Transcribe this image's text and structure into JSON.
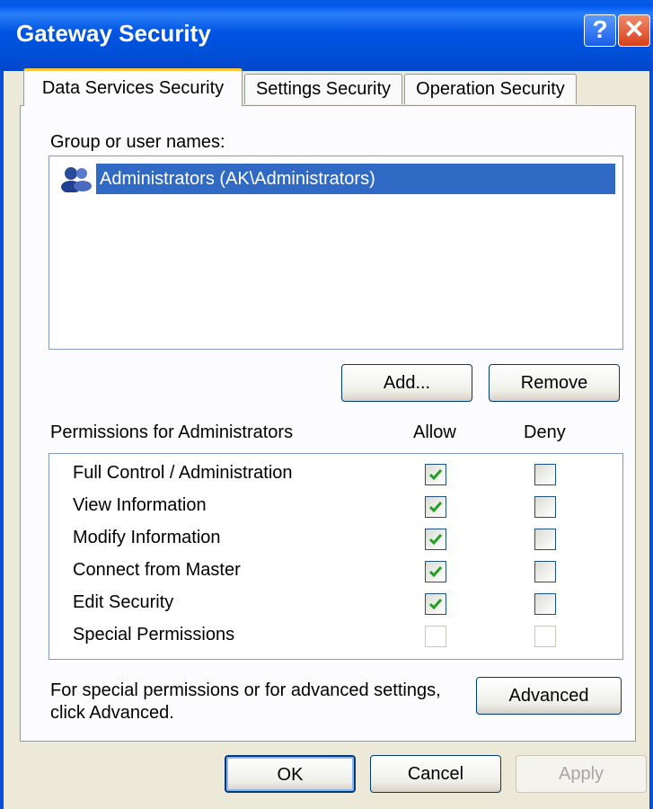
{
  "window": {
    "title": "Gateway Security",
    "help_glyph": "?",
    "close_glyph": "✕"
  },
  "tabs": [
    {
      "label": "Data Services Security",
      "active": true
    },
    {
      "label": "Settings Security",
      "active": false
    },
    {
      "label": "Operation Security",
      "active": false
    }
  ],
  "users": {
    "label": "Group or user names:",
    "items": [
      {
        "name": "Administrators (AK\\Administrators)",
        "selected": true,
        "icon": "group-icon"
      }
    ]
  },
  "user_buttons": {
    "add": "Add...",
    "remove": "Remove"
  },
  "permissions": {
    "header": "Permissions for Administrators",
    "allow_label": "Allow",
    "deny_label": "Deny",
    "rows": [
      {
        "name": "Full Control / Administration",
        "allow": true,
        "deny": false,
        "enabled": true
      },
      {
        "name": "View Information",
        "allow": true,
        "deny": false,
        "enabled": true
      },
      {
        "name": "Modify Information",
        "allow": true,
        "deny": false,
        "enabled": true
      },
      {
        "name": "Connect from Master",
        "allow": true,
        "deny": false,
        "enabled": true
      },
      {
        "name": "Edit Security",
        "allow": true,
        "deny": false,
        "enabled": true
      },
      {
        "name": "Special Permissions",
        "allow": false,
        "deny": false,
        "enabled": false
      }
    ]
  },
  "advanced": {
    "text_line1": "For special permissions or for advanced settings,",
    "text_line2": "click Advanced.",
    "button": "Advanced"
  },
  "footer": {
    "ok": "OK",
    "cancel": "Cancel",
    "apply": "Apply"
  },
  "colors": {
    "titlebar": "#0054e3",
    "selection": "#316ac5",
    "check": "#21a121",
    "tab_highlight": "#ffc83c"
  }
}
